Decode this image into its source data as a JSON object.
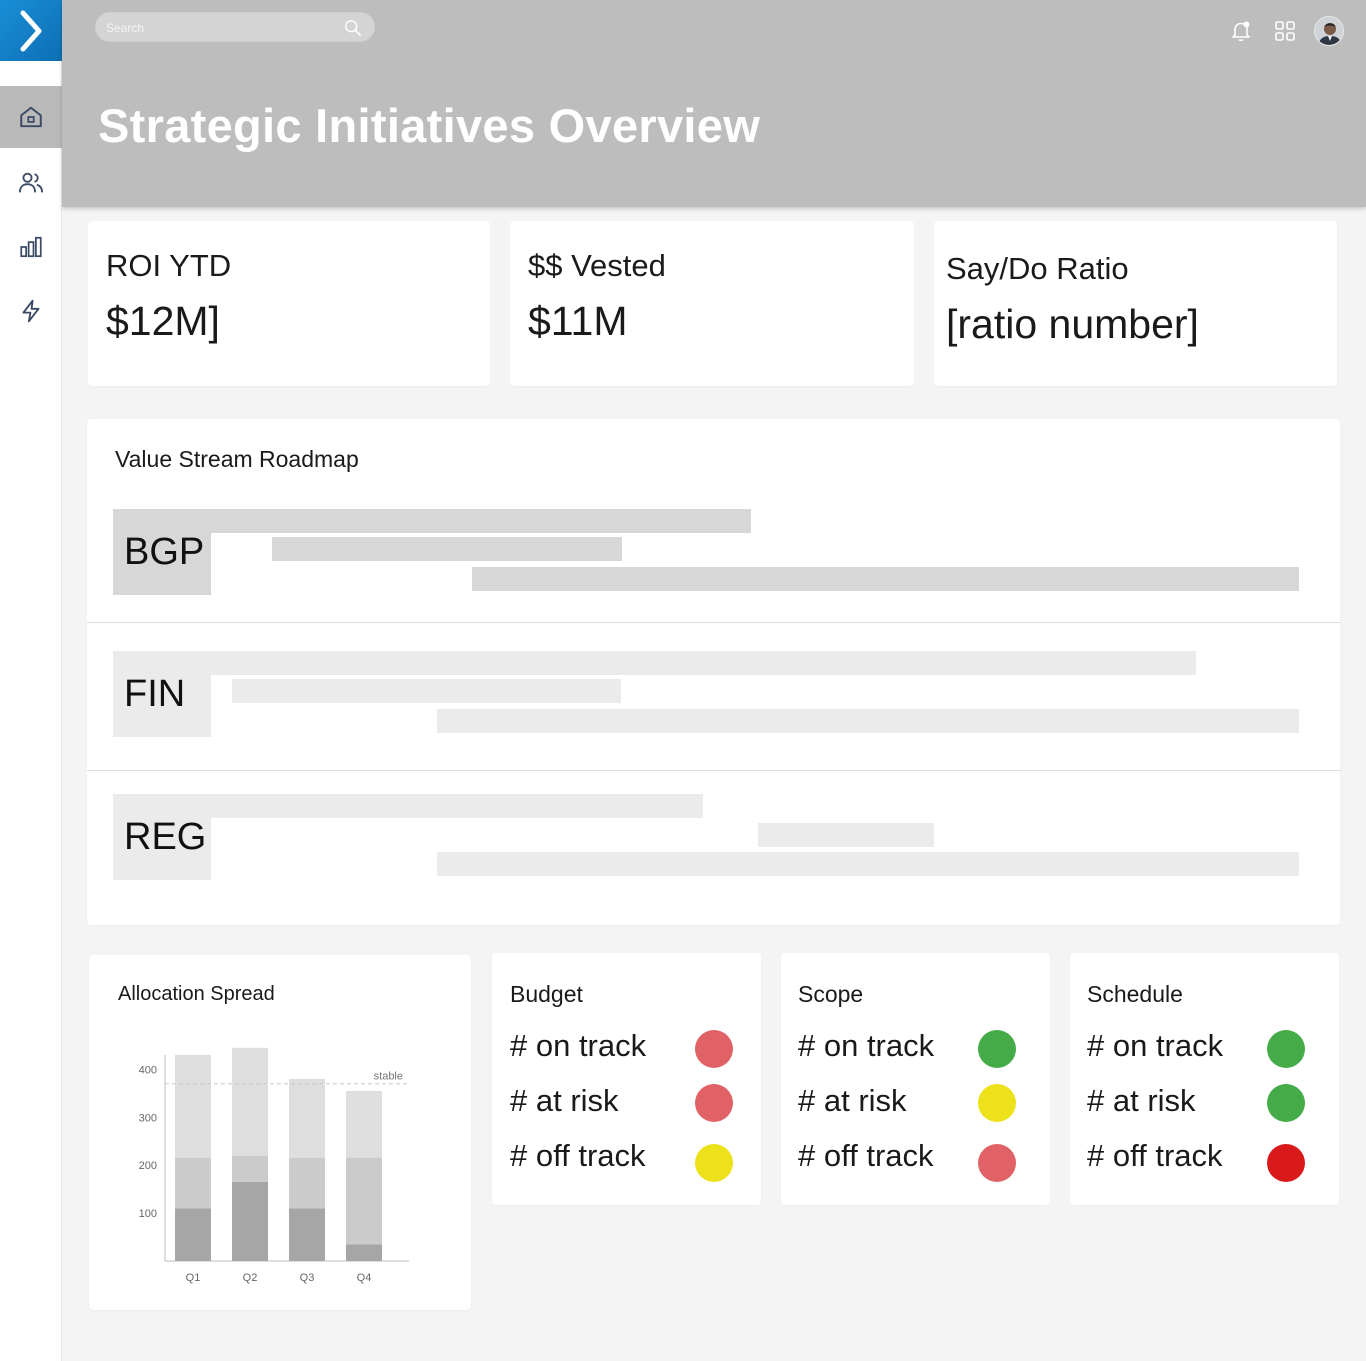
{
  "header": {
    "title": "Strategic Initiatives Overview",
    "search_placeholder": "Search",
    "icons": [
      "bell-icon",
      "apps-grid-icon",
      "avatar"
    ]
  },
  "sidebar": {
    "items": [
      {
        "icon": "home-icon",
        "active": true
      },
      {
        "icon": "users-icon",
        "active": false
      },
      {
        "icon": "bar-chart-icon",
        "active": false
      },
      {
        "icon": "lightning-icon",
        "active": false
      }
    ]
  },
  "kpis": [
    {
      "label": "ROI YTD",
      "value": "$12M]"
    },
    {
      "label": "$$ Vested",
      "value": "$11M"
    },
    {
      "label": "Say/Do Ratio",
      "value": "[ratio number]"
    }
  ],
  "roadmap": {
    "title": "Value Stream Roadmap",
    "rows": [
      {
        "label": "BGP"
      },
      {
        "label": "FIN"
      },
      {
        "label": "REG"
      }
    ]
  },
  "allocation": {
    "title": "Allocation Spread"
  },
  "chart_data": {
    "type": "bar",
    "stacked": true,
    "categories": [
      "Q1",
      "Q2",
      "Q3",
      "Q4"
    ],
    "series": [
      {
        "values": [
          110,
          165,
          110,
          35
        ]
      },
      {
        "values": [
          105,
          55,
          105,
          180
        ]
      },
      {
        "values": [
          215,
          225,
          165,
          140
        ]
      }
    ],
    "y_ticks": [
      100,
      200,
      300,
      400
    ],
    "ylim": [
      0,
      430
    ],
    "reference_line": {
      "value": 370,
      "label": "stable"
    },
    "colors": [
      "#a6a6a6",
      "#cbcbcb",
      "#dedede"
    ],
    "grid": false
  },
  "status_cards": [
    {
      "title": "Budget",
      "rows": [
        {
          "label": "# on track",
          "color": "#e06266"
        },
        {
          "label": "# at risk",
          "color": "#e06266"
        },
        {
          "label": "# off track",
          "color": "#ede11a"
        }
      ]
    },
    {
      "title": "Scope",
      "rows": [
        {
          "label": "# on track",
          "color": "#45ab48"
        },
        {
          "label": "# at risk",
          "color": "#ede11a"
        },
        {
          "label": "# off track",
          "color": "#e06266"
        }
      ]
    },
    {
      "title": "Schedule",
      "rows": [
        {
          "label": "# on track",
          "color": "#45ab48"
        },
        {
          "label": "# at risk",
          "color": "#45ab48"
        },
        {
          "label": "# off track",
          "color": "#d91a1a"
        }
      ]
    }
  ]
}
